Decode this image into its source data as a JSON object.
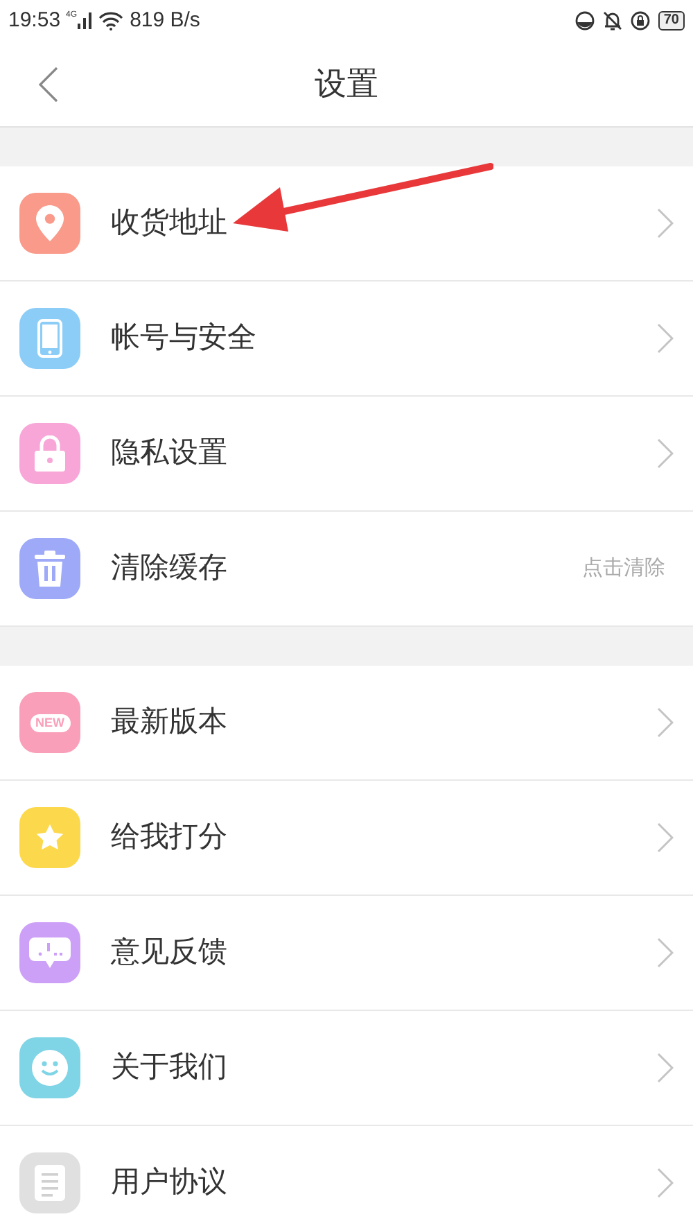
{
  "status_bar": {
    "time": "19:53",
    "network": "4G",
    "speed": "819 B/s",
    "battery": "70"
  },
  "header": {
    "title": "设置"
  },
  "groups": [
    {
      "items": [
        {
          "label": "收货地址",
          "color": "#f99a8a",
          "kind": "link"
        },
        {
          "label": "帐号与安全",
          "color": "#8ccdf8",
          "kind": "link"
        },
        {
          "label": "隐私设置",
          "color": "#f8a6d8",
          "kind": "link"
        },
        {
          "label": "清除缓存",
          "color": "#9ea9f8",
          "kind": "action",
          "hint": "点击清除"
        }
      ]
    },
    {
      "items": [
        {
          "label": "最新版本",
          "icon_text": "NEW",
          "color": "#f99fb9",
          "kind": "link"
        },
        {
          "label": "给我打分",
          "color": "#fcd84c",
          "kind": "link"
        },
        {
          "label": "意见反馈",
          "color": "#cda0f7",
          "kind": "link"
        },
        {
          "label": "关于我们",
          "color": "#7fd4e6",
          "kind": "link"
        },
        {
          "label": "用户协议",
          "color": "#e0e0e0",
          "kind": "link"
        }
      ]
    }
  ],
  "annotation": {
    "kind": "arrow",
    "color": "#e8383a"
  }
}
